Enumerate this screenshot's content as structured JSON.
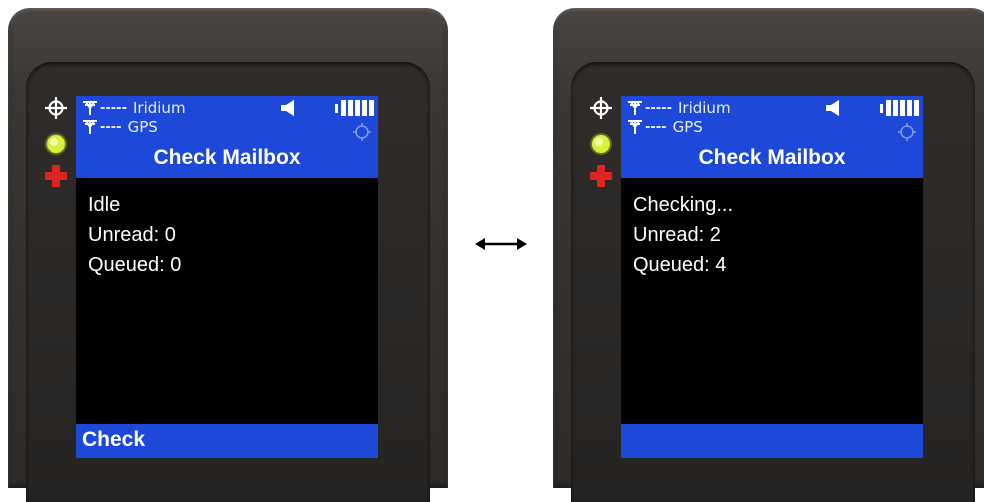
{
  "colors": {
    "header_blue": "#1e48d8",
    "screen_bg": "#000000",
    "text": "#ffffff",
    "indicator_green": "#d8f23a",
    "emergency_red": "#e02424"
  },
  "icons": {
    "side": [
      "gps-crosshair-icon",
      "status-led-icon",
      "emergency-cross-icon"
    ],
    "status": [
      "antenna-icon",
      "speaker-icon",
      "battery-icon",
      "gps-target-icon"
    ],
    "between": "double-arrow-icon"
  },
  "device_idle": {
    "status": {
      "signal_row1_dashes": "-----",
      "signal_row1_label": "Iridium",
      "signal_row2_dashes": "----",
      "signal_row2_label": "GPS",
      "title": "Check Mailbox"
    },
    "lines": [
      "Idle",
      "Unread: 0",
      "Queued: 0"
    ],
    "softkey": "Check"
  },
  "device_checking": {
    "status": {
      "signal_row1_dashes": "-----",
      "signal_row1_label": "Iridium",
      "signal_row2_dashes": "----",
      "signal_row2_label": "GPS",
      "title": "Check Mailbox"
    },
    "lines": [
      "Checking...",
      "Unread: 2",
      "Queued: 4"
    ],
    "softkey": ""
  }
}
